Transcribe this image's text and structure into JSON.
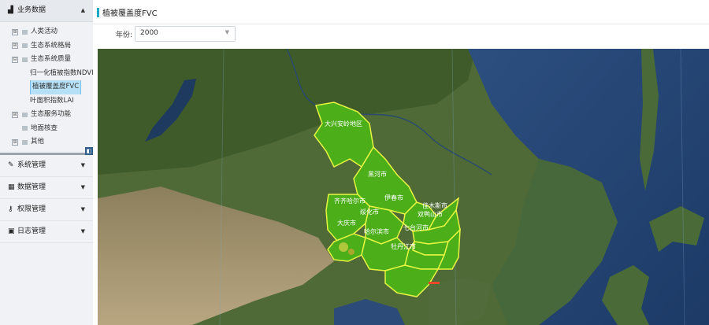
{
  "sidebar": {
    "business": {
      "label": "业务数据"
    },
    "tree": [
      {
        "label": "人类活动",
        "level": 1,
        "box": "⊞"
      },
      {
        "label": "生态系统格局",
        "level": 1,
        "box": "⊞"
      },
      {
        "label": "生态系统质量",
        "level": 1,
        "box": "⊟"
      },
      {
        "label": "归一化植被指数NDVI",
        "level": 2
      },
      {
        "label": "植被覆盖度FVC",
        "level": 2,
        "selected": true
      },
      {
        "label": "叶面积指数LAI",
        "level": 2
      },
      {
        "label": "生态服务功能",
        "level": 1,
        "box": "⊞"
      },
      {
        "label": "地面核查",
        "level": 1,
        "box": ""
      },
      {
        "label": "其他",
        "level": 1,
        "box": "⊞"
      }
    ],
    "collapse_glyph": "◧",
    "sections": [
      {
        "label": "系统管理",
        "icon": "wrench-icon"
      },
      {
        "label": "数据管理",
        "icon": "table-icon"
      },
      {
        "label": "权限管理",
        "icon": "user-key-icon"
      },
      {
        "label": "日志管理",
        "icon": "lock-icon"
      }
    ]
  },
  "page": {
    "title": "植被覆盖度FVC"
  },
  "filter": {
    "year_label": "年份:",
    "year_value": "2000"
  },
  "map": {
    "cities": [
      "大兴安岭地区",
      "黑河市",
      "伊春市",
      "齐齐哈尔市",
      "绥化市",
      "佳木斯市",
      "双鸭山市",
      "大庆市",
      "哈尔滨市",
      "七台河市",
      "牡丹江市"
    ],
    "colors": {
      "region_fill": "#4caf1a",
      "region_border": "#e6f542",
      "accent": "#1aa8c7"
    }
  }
}
